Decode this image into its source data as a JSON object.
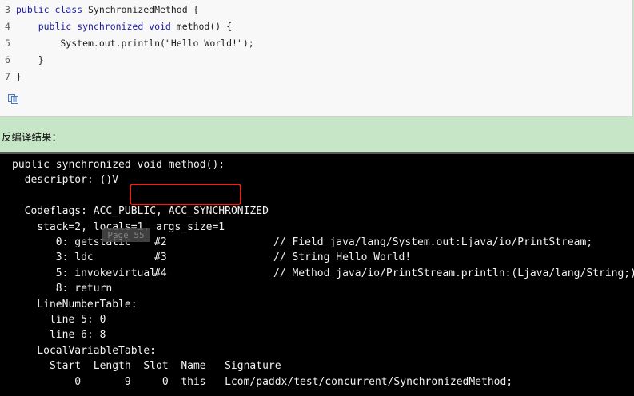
{
  "source_code": {
    "lines": [
      {
        "num": "3",
        "parts": [
          {
            "t": "public class ",
            "k": true
          },
          {
            "t": "SynchronizedMethod {",
            "k": false
          }
        ]
      },
      {
        "num": "4",
        "parts": [
          {
            "t": "    public synchronized void ",
            "k": true
          },
          {
            "t": "method() {",
            "k": false
          }
        ]
      },
      {
        "num": "5",
        "parts": [
          {
            "t": "        System.out.println(\"Hello World!\");",
            "k": false
          }
        ]
      },
      {
        "num": "6",
        "parts": [
          {
            "t": "    }",
            "k": false
          }
        ]
      },
      {
        "num": "7",
        "parts": [
          {
            "t": "}",
            "k": false
          }
        ]
      }
    ],
    "copy_icon": "copy-icon"
  },
  "caption": "反编译结果：",
  "bytecode": {
    "header": "public synchronized void method();",
    "descriptor": "  descriptor: ()V",
    "flags_prefix": "  flags: ACC_PUBLIC, ",
    "flags_highlight": "ACC_SYNCHRONIZED",
    "code_label": "  Code:",
    "stack": "    stack=2, locals=1, args_size=1",
    "instructions": [
      {
        "op": "       0: getstatic",
        "arg": "#2",
        "comment": "// Field java/lang/System.out:Ljava/io/PrintStream;"
      },
      {
        "op": "       3: ldc",
        "arg": "#3",
        "comment": "// String Hello World!"
      },
      {
        "op": "       5: invokevirtual",
        "arg": "#4",
        "comment": "// Method java/io/PrintStream.println:(Ljava/lang/String;)V"
      },
      {
        "op": "       8: return",
        "arg": "",
        "comment": ""
      }
    ],
    "line_number_table": "    LineNumberTable:",
    "line_entries": [
      "      line 5: 0",
      "      line 6: 8"
    ],
    "local_variable_table": "    LocalVariableTable:",
    "lvt_header": "      Start  Length  Slot  Name   Signature",
    "lvt_row": "          0       9     0  this   Lcom/paddx/test/concurrent/SynchronizedMethod;"
  },
  "page_badge": "Page 55"
}
